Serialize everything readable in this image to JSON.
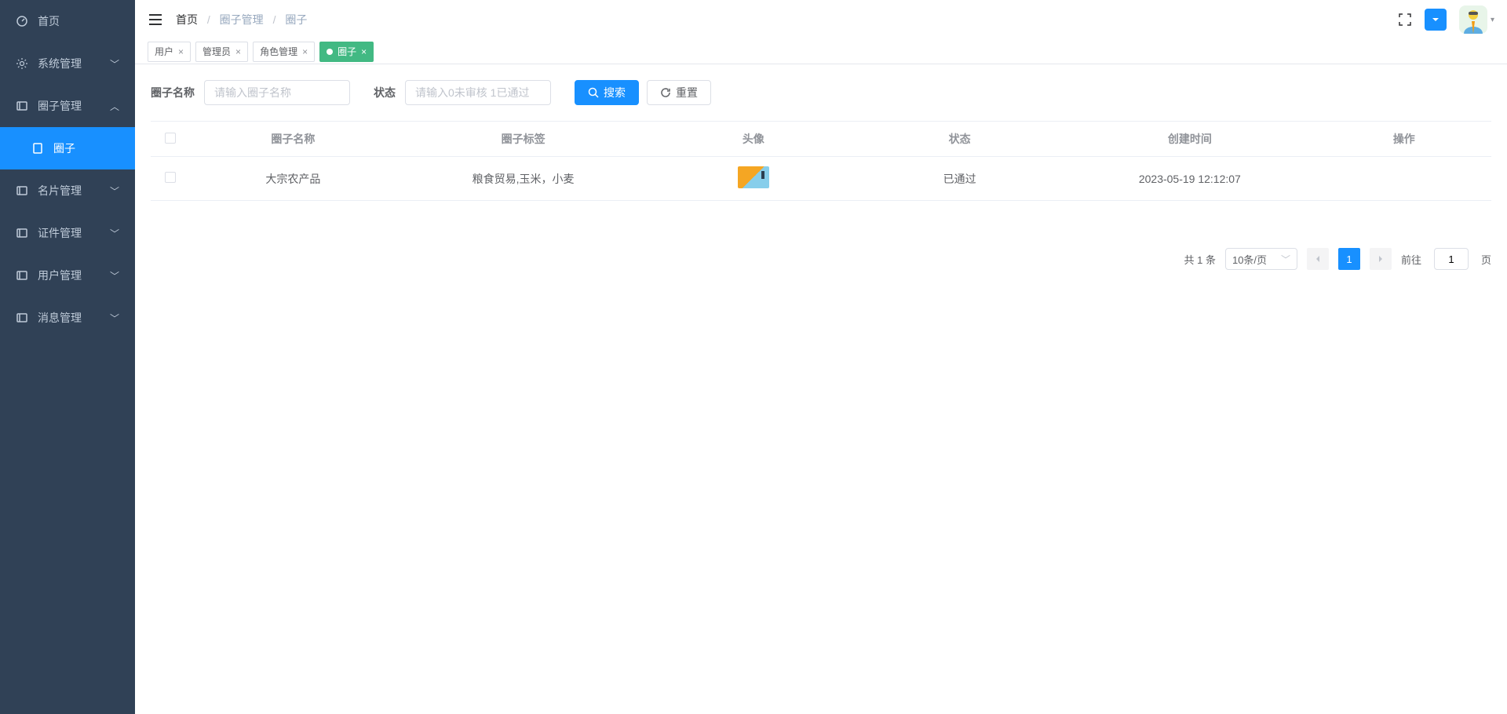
{
  "sidebar": {
    "items": [
      {
        "label": "首页",
        "icon": "dashboard"
      },
      {
        "label": "系统管理",
        "icon": "gear",
        "expandable": true,
        "expanded": false
      },
      {
        "label": "圈子管理",
        "icon": "folder",
        "expandable": true,
        "expanded": true
      },
      {
        "label": "圈子",
        "icon": "page",
        "sub": true,
        "active": true
      },
      {
        "label": "名片管理",
        "icon": "folder",
        "expandable": true,
        "expanded": false
      },
      {
        "label": "证件管理",
        "icon": "folder",
        "expandable": true,
        "expanded": false
      },
      {
        "label": "用户管理",
        "icon": "folder",
        "expandable": true,
        "expanded": false
      },
      {
        "label": "消息管理",
        "icon": "folder",
        "expandable": true,
        "expanded": false
      }
    ]
  },
  "breadcrumb": {
    "home": "首页",
    "mid": "圈子管理",
    "last": "圈子"
  },
  "tabs": [
    {
      "label": "用户",
      "active": false
    },
    {
      "label": "管理员",
      "active": false
    },
    {
      "label": "角色管理",
      "active": false
    },
    {
      "label": "圈子",
      "active": true
    }
  ],
  "search": {
    "name_label": "圈子名称",
    "name_placeholder": "请输入圈子名称",
    "status_label": "状态",
    "status_placeholder": "请输入0未审核 1已通过",
    "search_btn": "搜索",
    "reset_btn": "重置"
  },
  "table": {
    "headers": {
      "name": "圈子名称",
      "tags": "圈子标签",
      "avatar": "头像",
      "status": "状态",
      "time": "创建时间",
      "op": "操作"
    },
    "rows": [
      {
        "name": "大宗农产品",
        "tags": "粮食贸易,玉米，小麦",
        "status": "已通过",
        "time": "2023-05-19 12:12:07"
      }
    ]
  },
  "pagination": {
    "total_text": "共 1 条",
    "page_size": "10条/页",
    "current": "1",
    "goto_label": "前往",
    "goto_value": "1",
    "page_suffix": "页"
  }
}
